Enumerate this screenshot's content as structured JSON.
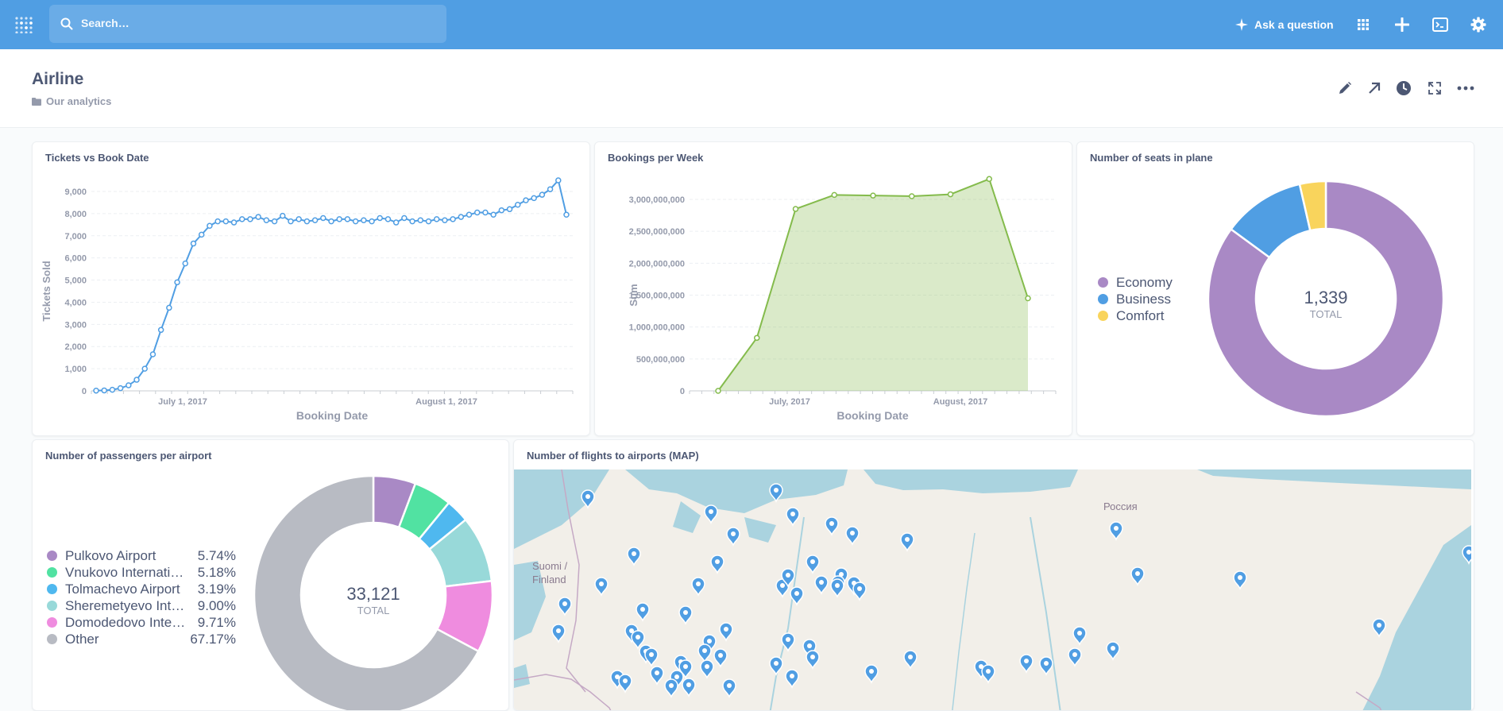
{
  "topbar": {
    "search_placeholder": "Search…",
    "ask_label": "Ask a question"
  },
  "header": {
    "title": "Airline",
    "collection": "Our analytics"
  },
  "cards": {
    "tickets": {
      "title": "Tickets vs Book Date"
    },
    "bookings": {
      "title": "Bookings per Week"
    },
    "seats": {
      "title": "Number of seats in plane"
    },
    "passengers": {
      "title": "Number of passengers per airport"
    },
    "map": {
      "title": "Number of flights to airports (MAP)",
      "label_russia": "Россия",
      "label_finland_1": "Suomi /",
      "label_finland_2": "Finland"
    }
  },
  "chart_data": [
    {
      "id": "tickets",
      "type": "line",
      "title": "Tickets vs Book Date",
      "xlabel": "Booking Date",
      "ylabel": "Tickets Sold",
      "color": "#509ee3",
      "x_ticks": [
        "July 1, 2017",
        "August 1, 2017"
      ],
      "y_ticks": [
        "0",
        "1,000",
        "2,000",
        "3,000",
        "4,000",
        "5,000",
        "6,000",
        "7,000",
        "8,000",
        "9,000"
      ],
      "ylim": [
        0,
        9000
      ],
      "values": [
        10,
        20,
        50,
        120,
        250,
        500,
        1000,
        1650,
        2750,
        3750,
        4900,
        5750,
        6650,
        7050,
        7450,
        7650,
        7650,
        7600,
        7750,
        7750,
        7850,
        7700,
        7650,
        7900,
        7650,
        7750,
        7650,
        7700,
        7800,
        7650,
        7750,
        7750,
        7650,
        7700,
        7650,
        7800,
        7750,
        7600,
        7800,
        7650,
        7700,
        7650,
        7750,
        7700,
        7750,
        7850,
        7950,
        8050,
        8050,
        7950,
        8150,
        8200,
        8400,
        8600,
        8700,
        8850,
        9100,
        9500,
        7950
      ]
    },
    {
      "id": "bookings",
      "type": "area",
      "title": "Bookings per Week",
      "xlabel": "Booking Date",
      "ylabel": "Sum",
      "color": "#84bb4c",
      "x_ticks": [
        "July, 2017",
        "August, 2017"
      ],
      "y_ticks": [
        "0",
        "500,000,000",
        "1,000,000,000",
        "1,500,000,000",
        "2,000,000,000",
        "2,500,000,000",
        "3,000,000,000"
      ],
      "ylim": [
        0,
        3000000000
      ],
      "values": [
        0,
        830000000,
        2850000000,
        3070000000,
        3060000000,
        3050000000,
        3080000000,
        3320000000,
        1450000000
      ]
    },
    {
      "id": "seats",
      "type": "pie",
      "title": "Number of seats in plane",
      "total": "1,339",
      "total_label": "TOTAL",
      "slices": [
        {
          "name": "Economy",
          "value": 1139,
          "color": "#a989c5"
        },
        {
          "name": "Business",
          "value": 152,
          "color": "#509ee3"
        },
        {
          "name": "Comfort",
          "value": 48,
          "color": "#f9d45c"
        }
      ]
    },
    {
      "id": "passengers",
      "type": "pie",
      "title": "Number of passengers per airport",
      "total": "33,121",
      "total_label": "TOTAL",
      "slices": [
        {
          "name": "Pulkovo Airport",
          "pct": "5.74%",
          "value": 5.74,
          "color": "#a989c5"
        },
        {
          "name": "Vnukovo Internati…",
          "pct": "5.18%",
          "value": 5.18,
          "color": "#51e2a2"
        },
        {
          "name": "Tolmachevo Airport",
          "pct": "3.19%",
          "value": 3.19,
          "color": "#4fb8ef"
        },
        {
          "name": "Sheremetyevo Int…",
          "pct": "9.00%",
          "value": 9.0,
          "color": "#98d9d9"
        },
        {
          "name": "Domodedovo Inte…",
          "pct": "9.71%",
          "value": 9.71,
          "color": "#ef8cdf"
        },
        {
          "name": "Other",
          "pct": "67.17%",
          "value": 67.17,
          "color": "#b8bbc3"
        }
      ]
    }
  ]
}
